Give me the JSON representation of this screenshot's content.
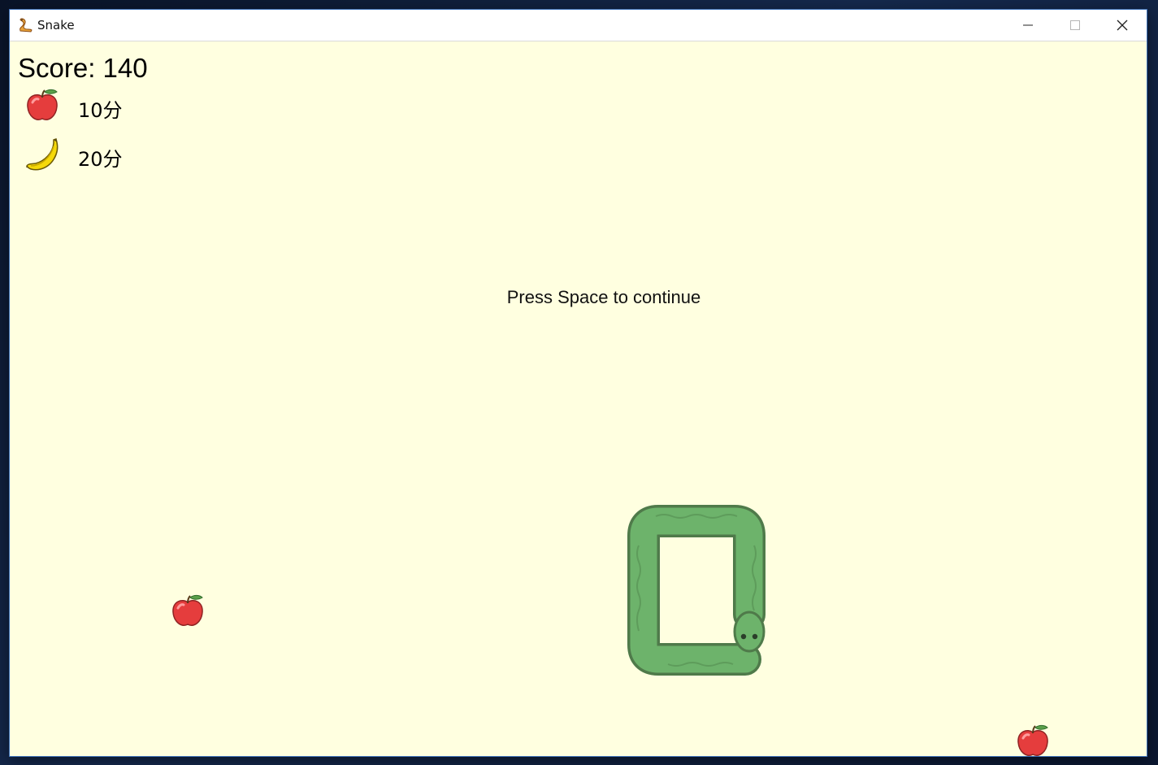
{
  "window": {
    "title": "Snake",
    "icon": "snake-app-icon",
    "controls": [
      "minimize-icon",
      "maximize-icon",
      "close-icon"
    ]
  },
  "game": {
    "score_text": "Score: 140",
    "message": "Press Space to continue",
    "background_color": "#ffffe0",
    "legend": [
      {
        "fruit": "apple",
        "points_text": "10分"
      },
      {
        "fruit": "banana",
        "points_text": "20分"
      }
    ],
    "board_fruits": [
      "apple",
      "apple"
    ],
    "snake": {
      "color": "#6db36b",
      "outline_color": "#4f7a4a"
    }
  }
}
